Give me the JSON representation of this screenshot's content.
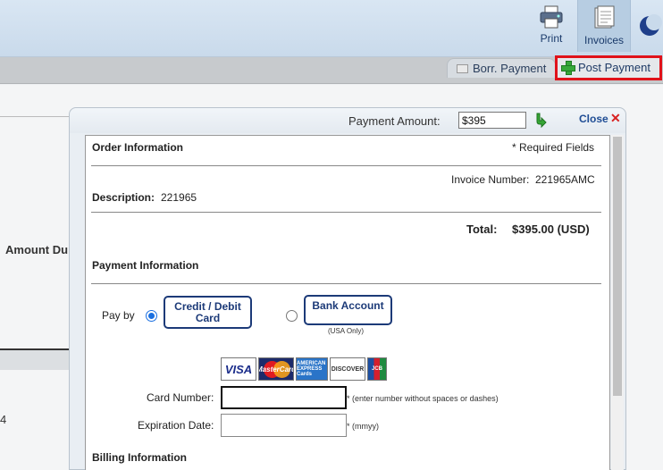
{
  "toolbar": {
    "print_label": "Print",
    "invoices_label": "Invoices"
  },
  "tabs": {
    "borr_payment": "Borr. Payment",
    "post_payment": "Post Payment"
  },
  "background": {
    "amount_due": "Amount Du",
    "number_fragment": "4"
  },
  "dialog": {
    "payment_amount_label": "Payment Amount:",
    "payment_amount_value": "$395",
    "close_label": "Close",
    "close_symbol": "✕",
    "order": {
      "section_title": "Order Information",
      "required_note": "* Required Fields",
      "invoice_label": "Invoice Number:",
      "invoice_value": "221965AMC",
      "description_label": "Description:",
      "description_value": "221965",
      "total_label": "Total:",
      "total_value": "$395.00 (USD)"
    },
    "payment": {
      "section_title": "Payment Information",
      "pay_by_label": "Pay by",
      "option_credit": "Credit / Debit Card",
      "option_bank": "Bank Account",
      "bank_note": "(USA Only)",
      "selected": "credit",
      "cards": [
        "VISA",
        "MasterCard",
        "AMERICAN EXPRESS Cards",
        "DISCOVER",
        "JCB"
      ],
      "card_number_label": "Card Number:",
      "card_number_value": "",
      "card_number_hint": "* (enter number without spaces or dashes)",
      "expiration_label": "Expiration Date:",
      "expiration_value": "",
      "expiration_hint": "* (mmyy)"
    },
    "billing": {
      "section_title": "Billing Information"
    }
  },
  "colors": {
    "highlight_border": "#e0121a",
    "dialog_accent": "#1c3a78",
    "close_x": "#d82020"
  }
}
